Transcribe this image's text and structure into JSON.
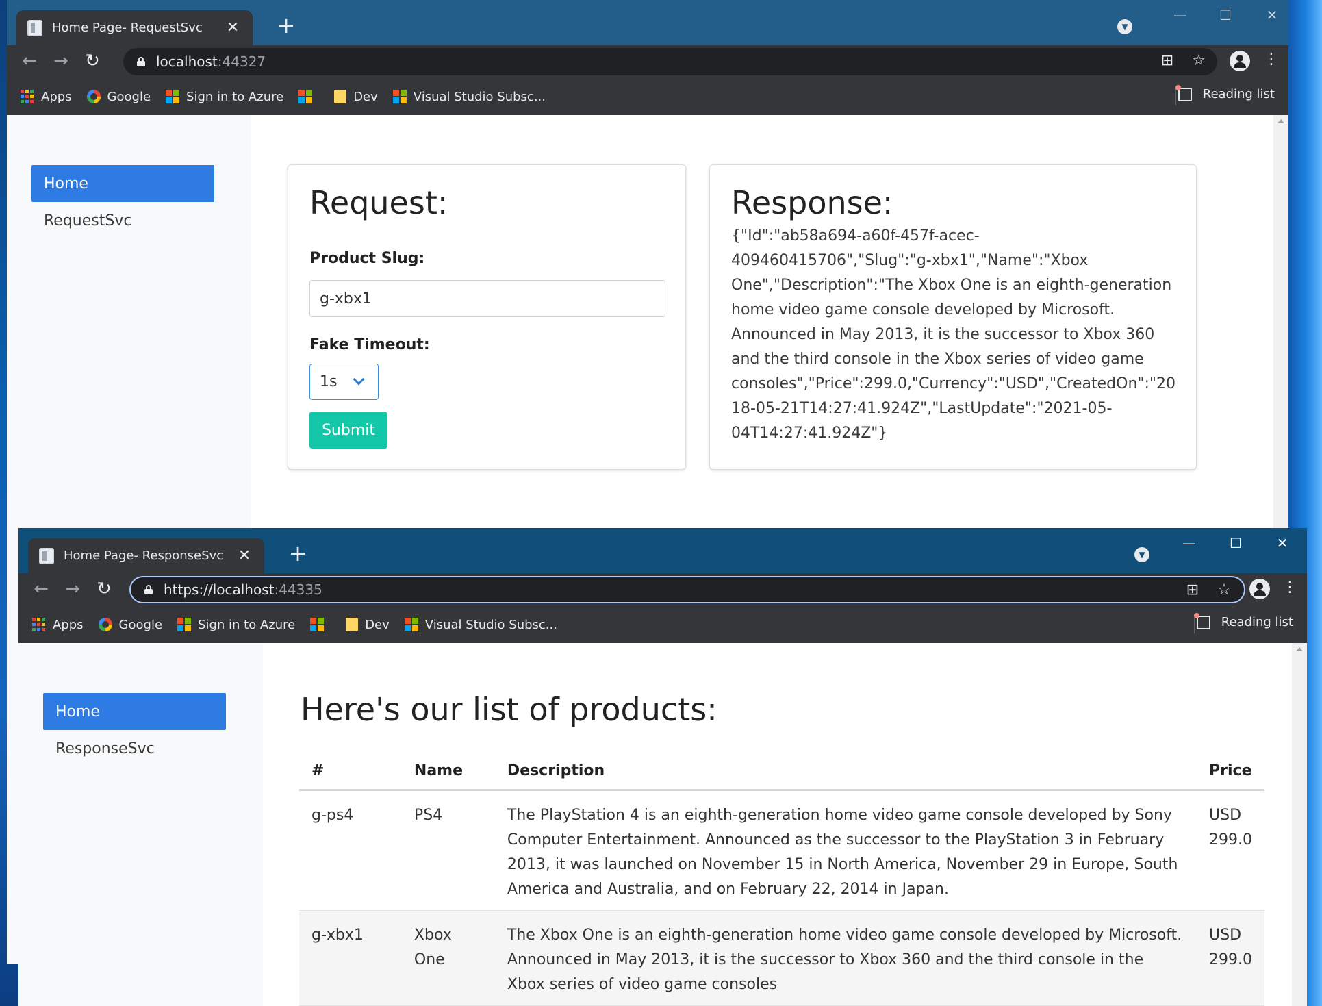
{
  "back_window": {
    "tab_title": "Home Page- RequestSvc",
    "url_host": "localhost",
    "url_port": ":44327",
    "bookmarks": [
      "Apps",
      "Google",
      "Sign in to Azure",
      "",
      "Dev",
      "Visual Studio Subsc..."
    ],
    "reading_list": "Reading list",
    "nav": {
      "home": "Home",
      "app": "RequestSvc"
    },
    "request_card": {
      "title": "Request:",
      "slug_label": "Product Slug:",
      "slug_value": "g-xbx1",
      "timeout_label": "Fake Timeout:",
      "timeout_value": "1s",
      "submit_label": "Submit"
    },
    "response_card": {
      "title": "Response:",
      "body": "{\"Id\":\"ab58a694-a60f-457f-acec-409460415706\",\"Slug\":\"g-xbx1\",\"Name\":\"Xbox One\",\"Description\":\"The Xbox One is an eighth-generation home video game console developed by Microsoft. Announced in May 2013, it is the successor to Xbox 360 and the third console in the Xbox series of video game consoles\",\"Price\":299.0,\"Currency\":\"USD\",\"CreatedOn\":\"2018-05-21T14:27:41.924Z\",\"LastUpdate\":\"2021-05-04T14:27:41.924Z\"}"
    }
  },
  "front_window": {
    "tab_title": "Home Page- ResponseSvc",
    "url_scheme": "https://",
    "url_host": "localhost",
    "url_port": ":44335",
    "bookmarks": [
      "Apps",
      "Google",
      "Sign in to Azure",
      "",
      "Dev",
      "Visual Studio Subsc..."
    ],
    "reading_list": "Reading list",
    "nav": {
      "home": "Home",
      "app": "ResponseSvc"
    },
    "products_title": "Here's our list of products:",
    "table": {
      "headers": [
        "#",
        "Name",
        "Description",
        "Price"
      ],
      "rows": [
        {
          "slug": "g-ps4",
          "name": "PS4",
          "description": "The PlayStation 4 is an eighth-generation home video game console developed by Sony Computer Entertainment. Announced as the successor to the PlayStation 3 in February 2013, it was launched on November 15 in North America, November 29 in Europe, South America and Australia, and on February 22, 2014 in Japan.",
          "price": "USD 299.0"
        },
        {
          "slug": "g-xbx1",
          "name": "Xbox One",
          "description": "The Xbox One is an eighth-generation home video game console developed by Microsoft. Announced in May 2013, it is the successor to Xbox 360 and the third console in the Xbox series of video game consoles",
          "price": "USD 299.0"
        }
      ]
    }
  },
  "colors": {
    "back_titlebar": "#235e8a",
    "front_titlebar": "#0f4f79",
    "chrome_toolbar": "#35363a",
    "nav_active": "#2e7be4",
    "submit": "#14c7a8"
  }
}
